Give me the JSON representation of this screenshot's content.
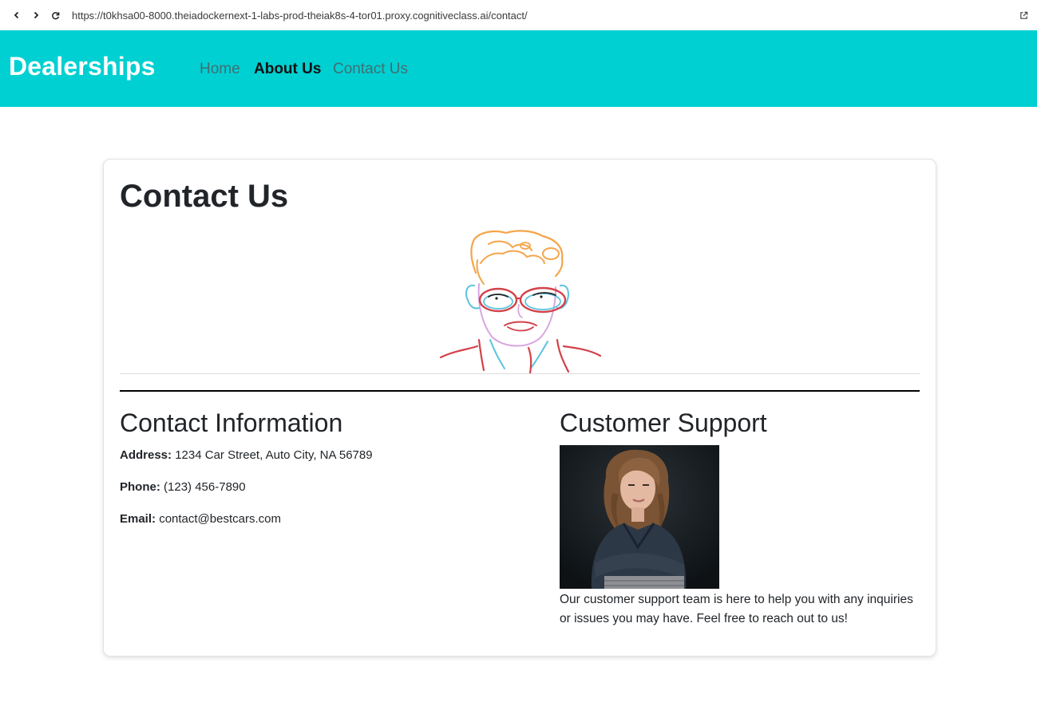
{
  "browser": {
    "url": "https://t0khsa00-8000.theiadockernext-1-labs-prod-theiak8s-4-tor01.proxy.cognitiveclass.ai/contact/",
    "icons": [
      "back-icon",
      "forward-icon",
      "reload-icon",
      "open-external-icon"
    ]
  },
  "header": {
    "brand": "Dealerships",
    "nav": [
      {
        "label": "Home",
        "active": false
      },
      {
        "label": "About Us",
        "active": true
      },
      {
        "label": "Contact Us",
        "active": false
      }
    ],
    "background_color": "#00d0d2"
  },
  "main": {
    "title": "Contact Us",
    "contact_info": {
      "heading": "Contact Information",
      "address_label": "Address:",
      "address": "1234 Car Street, Auto City, NA 56789",
      "phone_label": "Phone:",
      "phone": "(123) 456-7890",
      "email_label": "Email:",
      "email": "contact@bestcars.com"
    },
    "support": {
      "heading": "Customer Support",
      "text": "Our customer support team is here to help you with any inquiries or issues you may have. Feel free to reach out to us!"
    }
  }
}
